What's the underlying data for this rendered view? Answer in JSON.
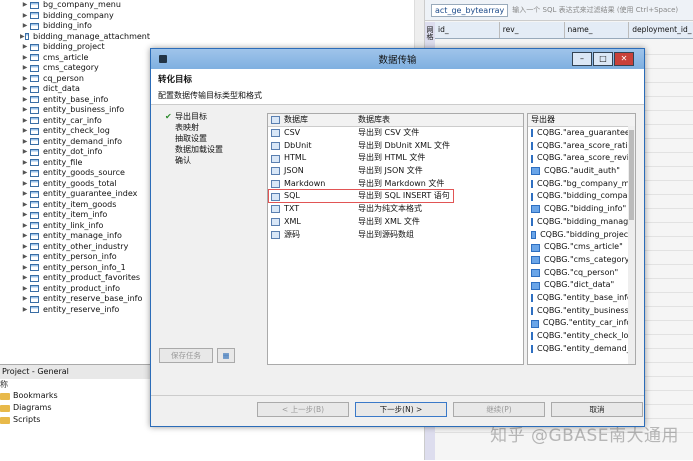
{
  "tree": {
    "items": [
      "bg_company_menu",
      "bidding_company",
      "bidding_info",
      "bidding_manage_attachment",
      "bidding_project",
      "cms_article",
      "cms_category",
      "cq_person",
      "dict_data",
      "entity_base_info",
      "entity_business_info",
      "entity_car_info",
      "entity_check_log",
      "entity_demand_info",
      "entity_dot_info",
      "entity_file",
      "entity_goods_source",
      "entity_goods_total",
      "entity_guarantee_index",
      "entity_item_goods",
      "entity_item_info",
      "entity_link_info",
      "entity_manage_info",
      "entity_other_industry",
      "entity_person_info",
      "entity_person_info_1",
      "entity_product_favorites",
      "entity_product_info",
      "entity_reserve_base_info",
      "entity_reserve_info"
    ]
  },
  "project": {
    "title": "Project - General",
    "subline": "称",
    "items": [
      "Bookmarks",
      "Diagrams",
      "Scripts"
    ]
  },
  "editor": {
    "tab": "act_ge_bytearray",
    "hint": "输入一个 SQL 表达式来过滤结果 (使用 Ctrl+Space)",
    "columns": [
      "id_",
      "rev_",
      "name_",
      "deployment_id_"
    ],
    "side_label": "网格"
  },
  "dialog": {
    "title": "数据传输",
    "header_title": "转化目标",
    "header_subtitle": "配置数据传输目标类型和格式",
    "steps": [
      {
        "label": "导出目标",
        "done": true
      },
      {
        "label": "表映射",
        "done": false
      },
      {
        "label": "抽取设置",
        "done": false
      },
      {
        "label": "数据加载设置",
        "done": false
      },
      {
        "label": "确认",
        "done": false
      }
    ],
    "save_task": "保存任务",
    "formats_header": [
      "数据库",
      "数据库表"
    ],
    "formats": [
      {
        "name": "CSV",
        "desc": "导出到 CSV 文件"
      },
      {
        "name": "DbUnit",
        "desc": "导出到 DbUnit XML 文件"
      },
      {
        "name": "HTML",
        "desc": "导出到 HTML 文件"
      },
      {
        "name": "JSON",
        "desc": "导出到 JSON 文件"
      },
      {
        "name": "Markdown",
        "desc": "导出到 Markdown 文件"
      },
      {
        "name": "SQL",
        "desc": "导出到 SQL INSERT 语句"
      },
      {
        "name": "TXT",
        "desc": "导出为纯文本格式"
      },
      {
        "name": "XML",
        "desc": "导出到 XML 文件"
      },
      {
        "name": "源码",
        "desc": "导出到源码数组"
      }
    ],
    "selected_format": "SQL",
    "target_header": "导出器",
    "targets": [
      "CQBG.\"area_guarantee_i",
      "CQBG.\"area_score_ratio\"",
      "CQBG.\"area_score_revise",
      "CQBG.\"audit_auth\"",
      "CQBG.\"bg_company_men",
      "CQBG.\"bidding_company",
      "CQBG.\"bidding_info\"",
      "CQBG.\"bidding_manage_",
      "CQBG.\"bidding_project\"",
      "CQBG.\"cms_article\"",
      "CQBG.\"cms_category\"",
      "CQBG.\"cq_person\"",
      "CQBG.\"dict_data\"",
      "CQBG.\"entity_base_info\"",
      "CQBG.\"entity_business_in",
      "CQBG.\"entity_car_info\"",
      "CQBG.\"entity_check_log\"",
      "CQBG.\"entity_demand_in"
    ],
    "buttons": {
      "prev": "< 上一步(B)",
      "next": "下一步(N) >",
      "finish": "继续(P)",
      "cancel": "取消"
    }
  },
  "watermark": "知乎 @GBASE南大通用"
}
